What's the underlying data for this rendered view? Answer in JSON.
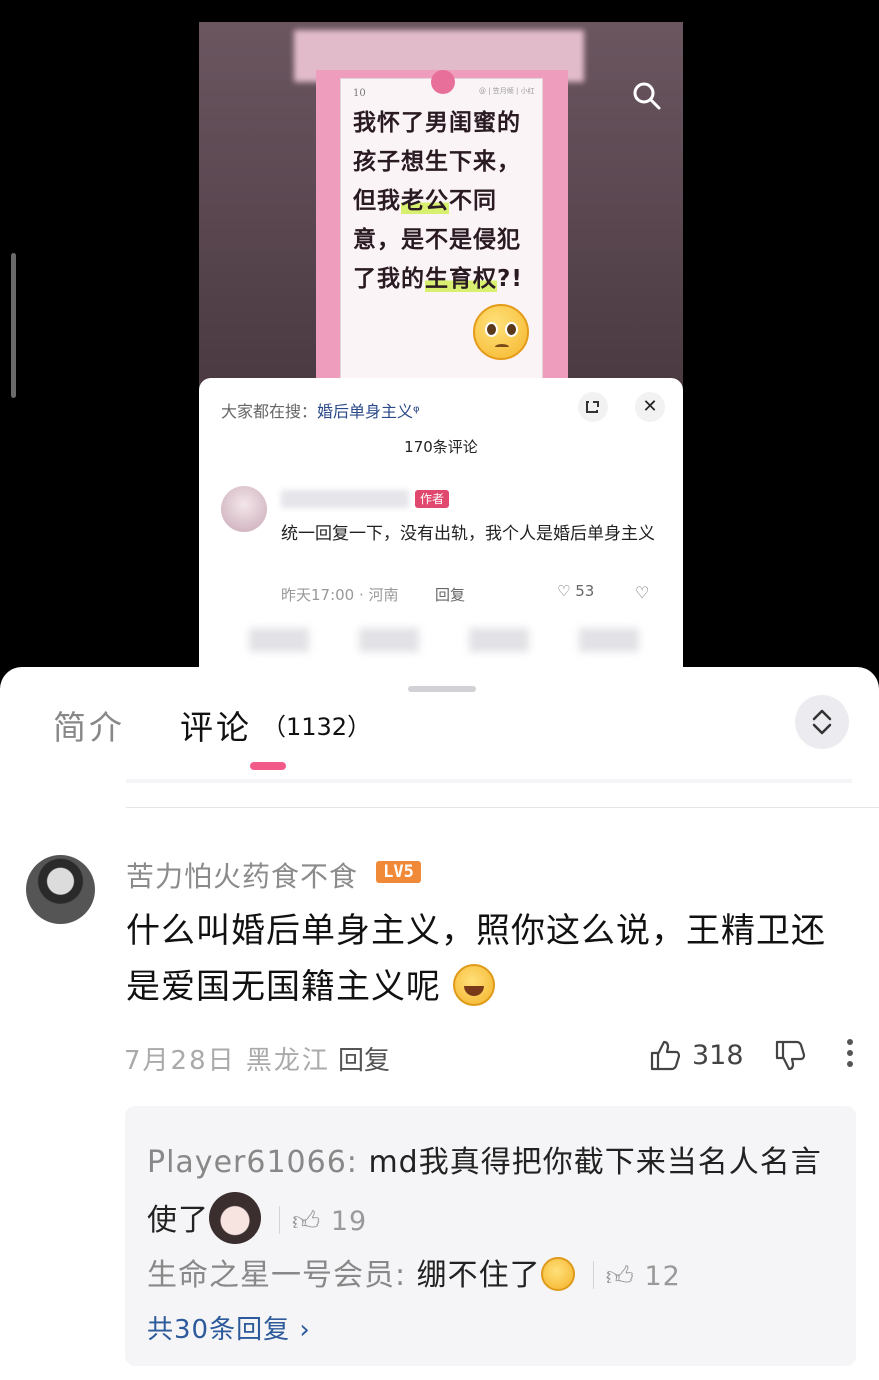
{
  "embedded_screenshot": {
    "poster": {
      "date": "10",
      "meta": "@ | 笠月倾 | 小红",
      "headline_parts": [
        "我怀了男闺蜜的孩子想生下来，但我",
        "老公",
        "不同意，是不是侵犯了我的",
        "生育权",
        "?!"
      ]
    },
    "sheet": {
      "hot_search_label": "大家都在搜：",
      "hot_search_term": "婚后单身主义",
      "comment_count": "170条评论",
      "author_tag": "作者",
      "comment_text": "统一回复一下，没有出轨，我个人是婚后单身主义",
      "meta": "昨天17:00 · 河南",
      "reply_label": "回复",
      "likes": "53"
    }
  },
  "tabs": {
    "intro": "简介",
    "comments": "评论",
    "comments_count": "（1132）"
  },
  "comment": {
    "username": "苦力怕火药食不食",
    "level": "LV5",
    "text": "什么叫婚后单身主义，照你这么说，王精卫还是爱国无国籍主义呢",
    "date_location": "7月28日 黑龙江",
    "reply_label": "回复",
    "likes": "318"
  },
  "replies": [
    {
      "name": "Player61066:",
      "text": " md我真得把你截下来当名人名言使了",
      "likes": "19"
    },
    {
      "name": "生命之星一号会员:",
      "text": " 绷不住了",
      "likes": "12"
    }
  ],
  "more_replies": "共30条回复",
  "colors": {
    "accent": "#f25a8a",
    "level_badge": "#f08a38",
    "link": "#2c5a9a"
  }
}
